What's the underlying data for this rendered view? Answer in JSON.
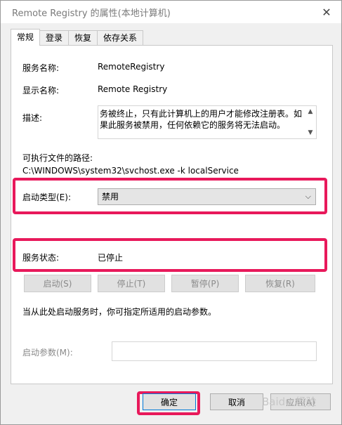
{
  "window": {
    "title": "Remote Registry 的属性(本地计算机)"
  },
  "tabs": [
    {
      "label": "常规"
    },
    {
      "label": "登录"
    },
    {
      "label": "恢复"
    },
    {
      "label": "依存关系"
    }
  ],
  "general": {
    "service_name_label": "服务名称:",
    "service_name_value": "RemoteRegistry",
    "display_name_label": "显示名称:",
    "display_name_value": "Remote Registry",
    "description_label": "描述:",
    "description_value": "务被终止，只有此计算机上的用户才能修改注册表。如果此服务被禁用，任何依赖它的服务将无法启动。",
    "path_label": "可执行文件的路径:",
    "path_value": "C:\\WINDOWS\\system32\\svchost.exe -k localService",
    "startup_type_label": "启动类型(E):",
    "startup_type_value": "禁用",
    "status_label": "服务状态:",
    "status_value": "已停止",
    "start_button": "启动(S)",
    "stop_button": "停止(T)",
    "pause_button": "暂停(P)",
    "resume_button": "恢复(R)",
    "hint_text": "当从此处启动服务时，你可指定所适用的启动参数。",
    "start_params_label": "启动参数(M):",
    "start_params_value": ""
  },
  "footer": {
    "ok_button": "确定",
    "cancel_button": "取消",
    "apply_button": "应用(A)"
  },
  "watermark": "Baidu 经验",
  "colors": {
    "highlight": "#e8195b"
  }
}
